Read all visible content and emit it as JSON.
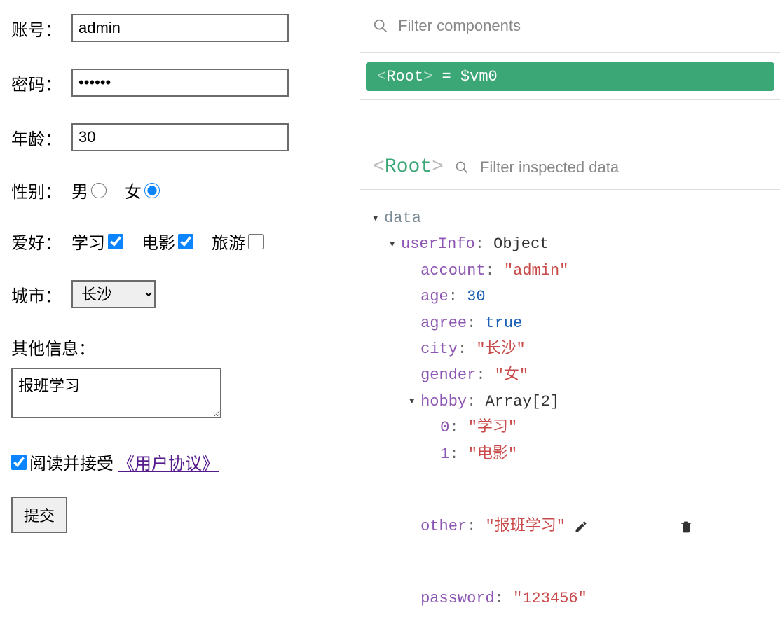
{
  "form": {
    "account": {
      "label": "账号：",
      "value": "admin"
    },
    "password": {
      "label": "密码：",
      "value": "••••••"
    },
    "age": {
      "label": "年龄：",
      "value": "30"
    },
    "gender": {
      "label": "性别：",
      "options": [
        {
          "label": "男",
          "checked": false
        },
        {
          "label": "女",
          "checked": true
        }
      ]
    },
    "hobby": {
      "label": "爱好：",
      "options": [
        {
          "label": "学习",
          "checked": true
        },
        {
          "label": "电影",
          "checked": true
        },
        {
          "label": "旅游",
          "checked": false
        }
      ]
    },
    "city": {
      "label": "城市：",
      "selected": "长沙"
    },
    "other": {
      "label": "其他信息：",
      "value": "报班学习"
    },
    "agree": {
      "checked": true,
      "text": "阅读并接受",
      "link": "《用户协议》"
    },
    "submit": "提交"
  },
  "devtools": {
    "filter_components_placeholder": "Filter components",
    "root_badge": {
      "tag": "Root",
      "assign": " = $vm0"
    },
    "inspector_title": "Root",
    "filter_inspected_placeholder": "Filter inspected data",
    "tree": {
      "data_label": "data",
      "userInfo_label": "userInfo",
      "object_label": "Object",
      "account_key": "account",
      "account_val": "\"admin\"",
      "age_key": "age",
      "age_val": "30",
      "agree_key": "agree",
      "agree_val": "true",
      "city_key": "city",
      "city_val": "\"长沙\"",
      "gender_key": "gender",
      "gender_val": "\"女\"",
      "hobby_key": "hobby",
      "hobby_type": "Array[2]",
      "hobby_0_key": "0",
      "hobby_0_val": "\"学习\"",
      "hobby_1_key": "1",
      "hobby_1_val": "\"电影\"",
      "other_key": "other",
      "other_val": "\"报班学习\"",
      "password_key": "password",
      "password_val": "\"123456\""
    }
  }
}
